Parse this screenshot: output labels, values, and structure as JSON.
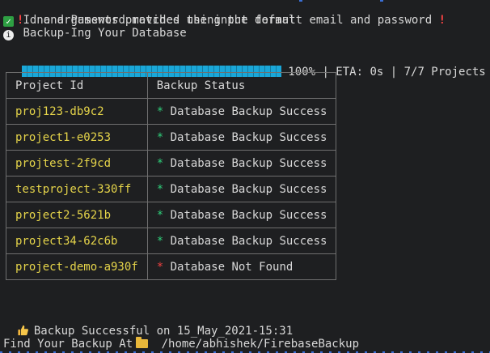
{
  "messages": {
    "line1": "no arguments provided using the default email and password",
    "line2": "Id and Password matches the input format",
    "line3": "Backup-Ing Your Database"
  },
  "progress": {
    "value": 1.0,
    "text": "100% | ETA: 0s | 7/7 Projects"
  },
  "table": {
    "headers": [
      "Project Id",
      "Backup Status"
    ],
    "rows": [
      {
        "id": "proj123-db9c2",
        "status": "Database Backup Success",
        "ok": true
      },
      {
        "id": "project1-e0253",
        "status": "Database Backup Success",
        "ok": true
      },
      {
        "id": "projtest-2f9cd",
        "status": "Database Backup Success",
        "ok": true
      },
      {
        "id": "testproject-330ff",
        "status": "Database Backup Success",
        "ok": true
      },
      {
        "id": "project2-5621b",
        "status": "Database Backup Success",
        "ok": true
      },
      {
        "id": "project34-62c6b",
        "status": "Database Backup Success",
        "ok": true
      },
      {
        "id": "project-demo-a930f",
        "status": "Database Not Found",
        "ok": false
      }
    ]
  },
  "summary": {
    "success": "Backup Successful on 15_May_2021-15:31",
    "location_label": "Find Your Backup At",
    "location_path": "/home/abhishek/FirebaseBackup"
  },
  "icons": {
    "warning": "exclamation-icon",
    "check": "check-icon",
    "info": "info-icon",
    "thumb": "thumbs-up-icon",
    "folder": "folder-icon"
  },
  "colors": {
    "background": "#1e1f21",
    "project_id": "#e5d44a",
    "success": "#2fd07a",
    "failure": "#ee4040",
    "progress": "#1aa7d8"
  }
}
